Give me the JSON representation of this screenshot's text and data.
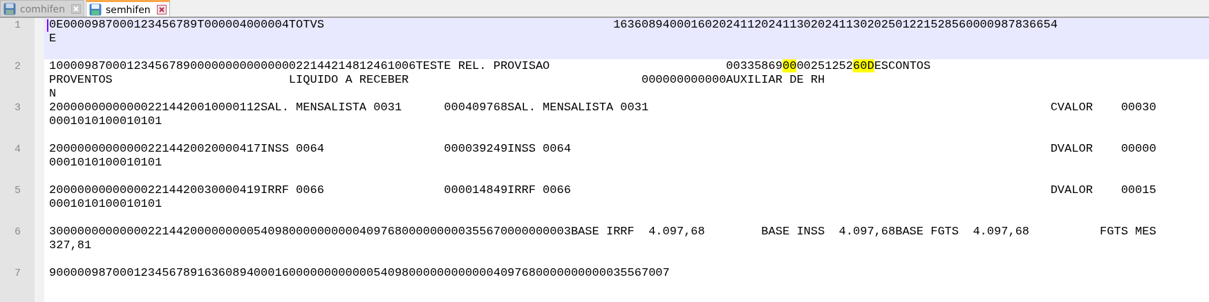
{
  "tabs": [
    {
      "label": "comhifen",
      "selected": false
    },
    {
      "label": "semhifen",
      "selected": true
    }
  ],
  "lines": [
    {
      "number": "1",
      "current": true,
      "rows": [
        [
          {
            "text": "0E0000987000123456789T000004000004TOTVS                                         163608940001602024112024113020241130202501221528560000987836654",
            "highlighted": false
          }
        ],
        [
          {
            "text": "E",
            "highlighted": false
          }
        ]
      ]
    },
    {
      "number": "2",
      "current": false,
      "rows": [
        [
          {
            "text": "1000098700012345678900000000000000022144214812461006TESTE REL. PROVISAO                         00335869",
            "highlighted": false
          },
          {
            "text": "00",
            "highlighted": true
          },
          {
            "text": "00251252",
            "highlighted": false
          },
          {
            "text": "60D",
            "highlighted": true
          },
          {
            "text": "ESCONTOS",
            "highlighted": false
          }
        ],
        [
          {
            "text": "PROVENTOS                         LIQUIDO A RECEBER                                 000000000000AUXILIAR DE RH",
            "highlighted": false
          }
        ],
        [
          {
            "text": "N",
            "highlighted": false
          }
        ]
      ]
    },
    {
      "number": "3",
      "current": false,
      "rows": [
        [
          {
            "text": "200000000000002214420010000112SAL. MENSALISTA 0031      000409768SAL. MENSALISTA 0031                                                         CVALOR    00030",
            "highlighted": false
          }
        ],
        [
          {
            "text": "0001010100010101",
            "highlighted": false
          }
        ]
      ]
    },
    {
      "number": "4",
      "current": false,
      "rows": [
        [
          {
            "text": "200000000000002214420020000417INSS 0064                 000039249INSS 0064                                                                    DVALOR    00000",
            "highlighted": false
          }
        ],
        [
          {
            "text": "0001010100010101",
            "highlighted": false
          }
        ]
      ]
    },
    {
      "number": "5",
      "current": false,
      "rows": [
        [
          {
            "text": "200000000000002214420030000419IRRF 0066                 000014849IRRF 0066                                                                    DVALOR    00015",
            "highlighted": false
          }
        ],
        [
          {
            "text": "0001010100010101",
            "highlighted": false
          }
        ]
      ]
    },
    {
      "number": "6",
      "current": false,
      "rows": [
        [
          {
            "text": "30000000000000221442000000000540980000000000409768000000000355670000000003BASE IRRF  4.097,68        BASE INSS  4.097,68BASE FGTS  4.097,68          FGTS MES",
            "highlighted": false
          }
        ],
        [
          {
            "text": "327,81",
            "highlighted": false
          }
        ]
      ]
    },
    {
      "number": "7",
      "current": false,
      "rows": [
        [
          {
            "text": "9000009870001234567891636089400016000000000000540980000000000004097680000000000035567007",
            "highlighted": false
          }
        ]
      ]
    }
  ]
}
